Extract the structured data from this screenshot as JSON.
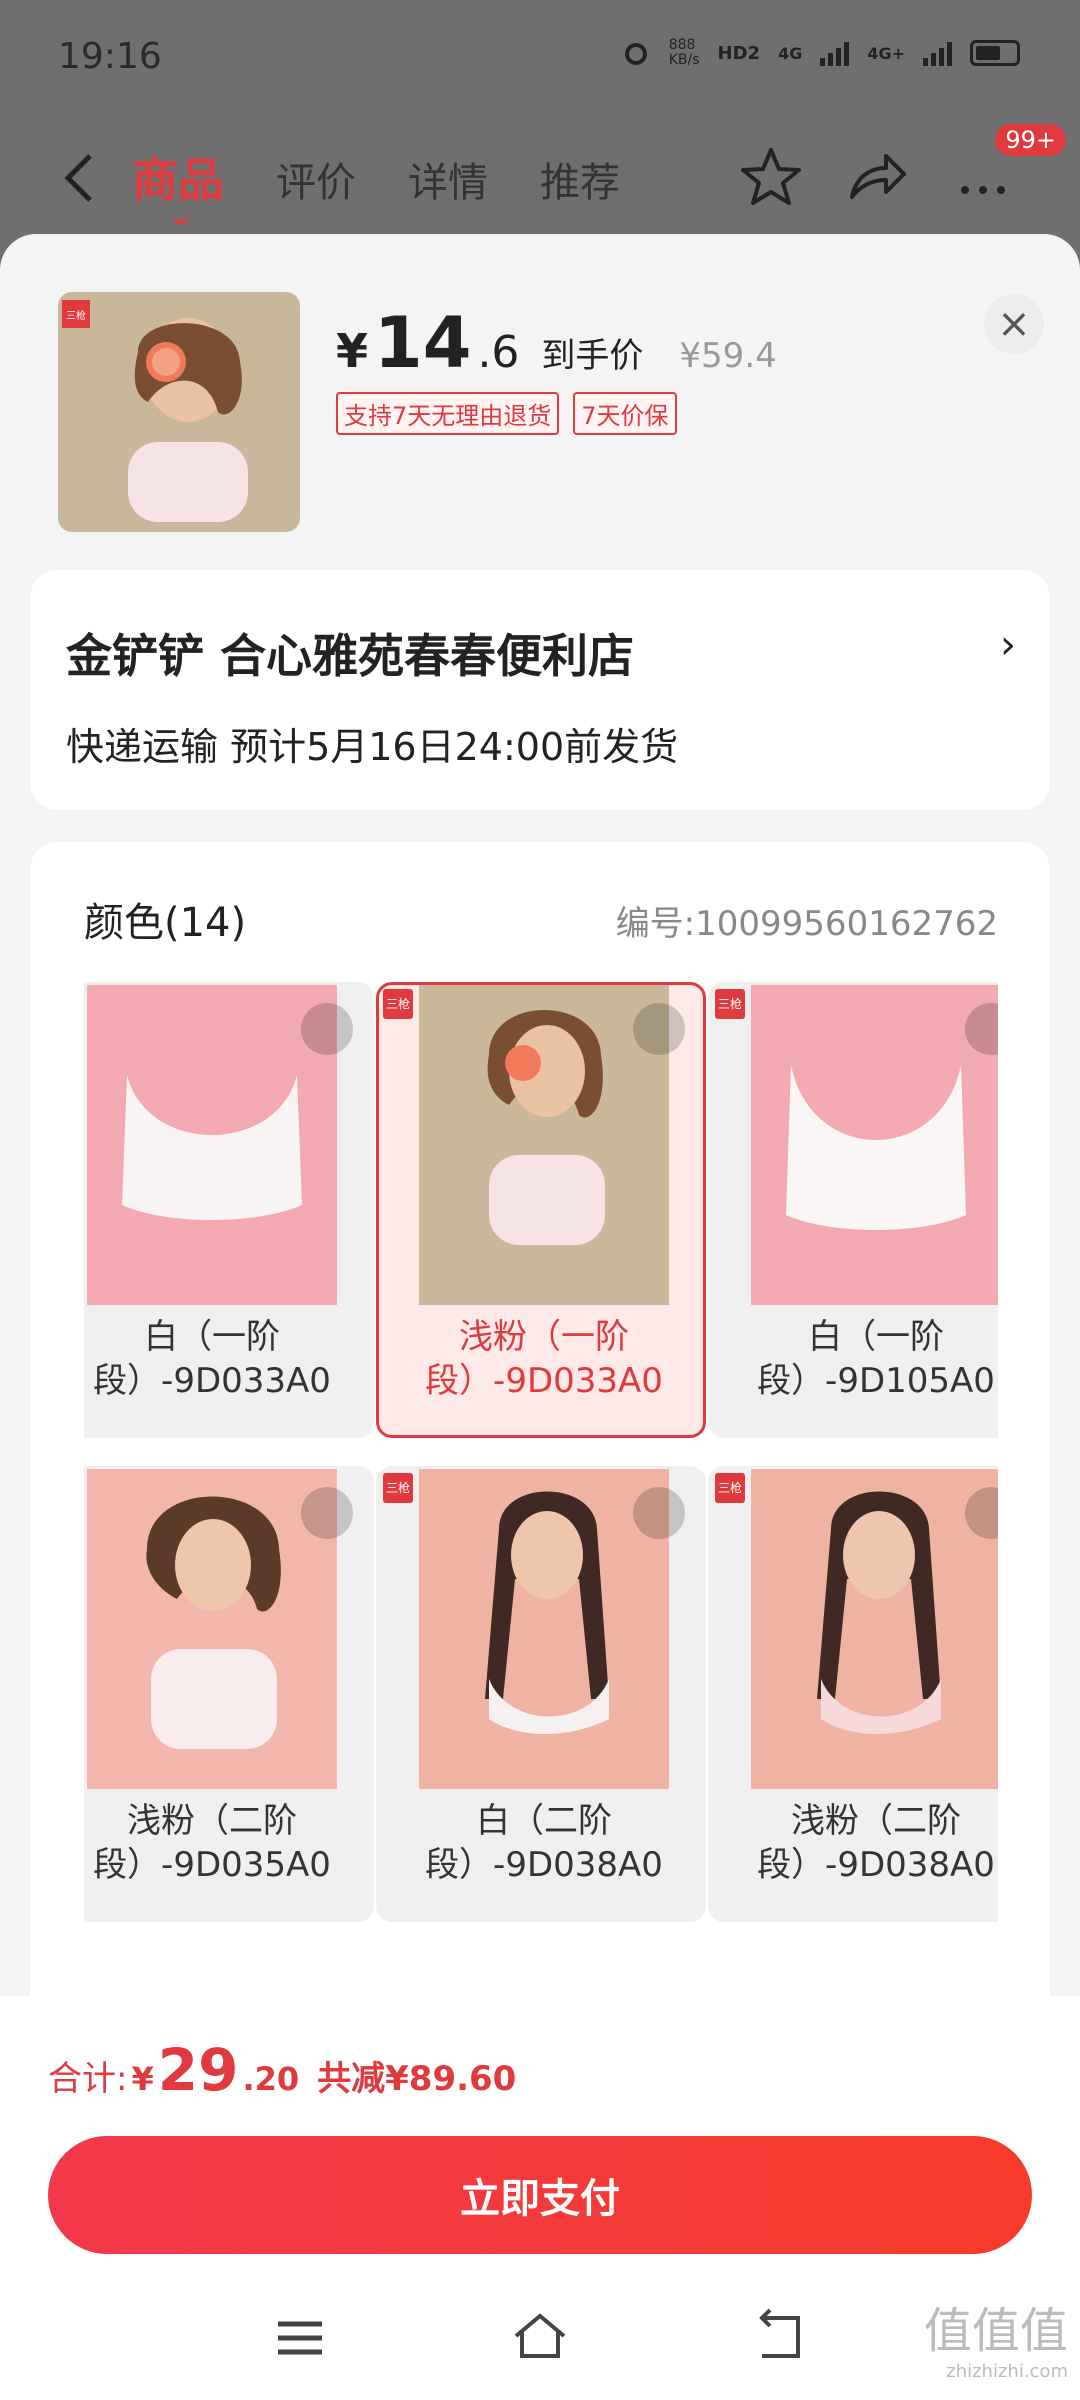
{
  "status_bar": {
    "time": "19:16",
    "net_speed": "888\nKB/s",
    "hd": "HD2",
    "sig1": "4G",
    "sig2": "4G+"
  },
  "top_nav": {
    "tabs": [
      {
        "label": "商品",
        "active": true
      },
      {
        "label": "评价",
        "active": false
      },
      {
        "label": "详情",
        "active": false
      },
      {
        "label": "推荐",
        "active": false
      }
    ],
    "badge": "99+"
  },
  "product": {
    "yen": "¥",
    "price_int": "14",
    "price_dec": ".6",
    "price_label": "到手价",
    "original_price": "¥59.4",
    "tags": [
      "支持7天无理由退货",
      "7天价保"
    ],
    "brand_mark": "三枪"
  },
  "store": {
    "name": "金铲铲  合心雅苑春春便利店",
    "shipping": "快递运输 预计5月16日24:00前发货"
  },
  "colors": {
    "title": "颜色(14)",
    "sku": "编号:10099560162762",
    "options": [
      {
        "line1": "白（一阶",
        "line2": "段）-9D033A0",
        "selected": false,
        "bg": "#f2a9b0"
      },
      {
        "line1": "浅粉（一阶",
        "line2": "段）-9D033A0",
        "selected": true,
        "bg": "#c9b89c"
      },
      {
        "line1": "白（一阶",
        "line2": "段）-9D105A0",
        "selected": false,
        "bg": "#f2a9b0"
      },
      {
        "line1": "浅粉（二阶",
        "line2": "段）-9D035A0",
        "selected": false,
        "bg": "#f2b6ac"
      },
      {
        "line1": "白（二阶",
        "line2": "段）-9D038A0",
        "selected": false,
        "bg": "#f0b3a3"
      },
      {
        "line1": "浅粉（二阶",
        "line2": "段）-9D038A0",
        "selected": false,
        "bg": "#f0b3a3"
      }
    ]
  },
  "footer": {
    "total_label": "合计:",
    "total_yen": "¥",
    "total_int": "29",
    "total_dec": ".20",
    "discount": "共减¥89.60",
    "pay_button": "立即支付"
  },
  "watermark": {
    "mark": "值值值",
    "site": "zhizhizhi.com"
  },
  "colors_theme": {
    "accent": "#e0393e"
  }
}
